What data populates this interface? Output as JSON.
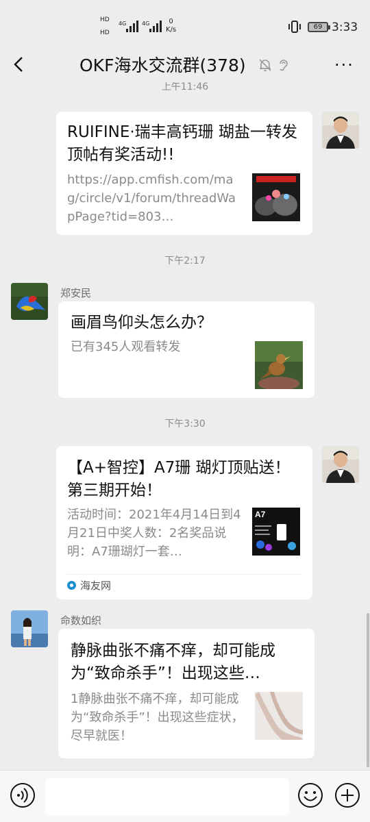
{
  "status_bar": {
    "hd1": "HD",
    "hd2": "HD",
    "net1": "4G",
    "net2": "4G",
    "speed_value": "0",
    "speed_unit": "K/s",
    "battery": "69",
    "time": "3:33"
  },
  "header": {
    "title": "OKF海水交流群(378)",
    "more_label": "···"
  },
  "messages": {
    "ts0": "上午11:46",
    "m1": {
      "title": "RUIFINE·瑞丰高钙珊 瑚盐一转发顶帖有奖活动!!",
      "desc": "https://app.cmfish.com/mag/circle/v1/forum/threadWapPage?tid=803…"
    },
    "ts1": "下午2:17",
    "m2": {
      "sender": "郑安民",
      "title": "画眉鸟仰头怎么办？",
      "desc": "已有345人观看转发"
    },
    "ts2": "下午3:30",
    "m3": {
      "title": "【A+智控】A7珊 瑚灯顶贴送！第三期开始！",
      "desc": "活动时间：2021年4月14日到4月21日中奖人数：2名奖品说明：A7珊瑚灯一套…",
      "source": "海友网",
      "thumb_label": "A7"
    },
    "m4": {
      "sender": "命数如织",
      "title": "静脉曲张不痛不痒，却可能成为“致命杀手”！出现这些…",
      "desc": "1静脉曲张不痛不痒，却可能成为“致命杀手”！出现这些症状，尽早就医！"
    }
  },
  "input_bar": {
    "placeholder": ""
  }
}
